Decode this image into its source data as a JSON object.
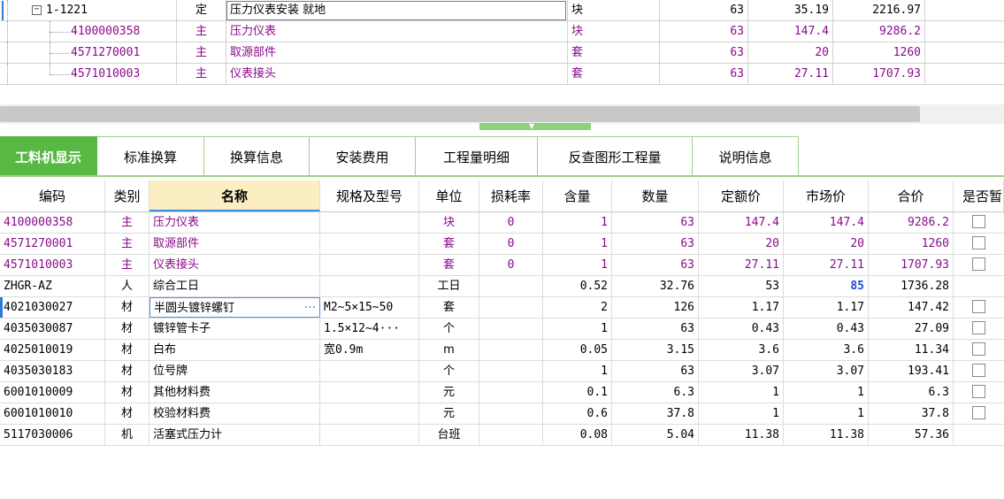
{
  "top_grid": {
    "rows": [
      {
        "code": "1-1221",
        "type": "定",
        "name": "压力仪表安装 就地",
        "unit": "块",
        "qty": "63",
        "price": "35.19",
        "total": "2216.97",
        "purple": false
      },
      {
        "code": "4100000358",
        "type": "主",
        "name": "压力仪表",
        "unit": "块",
        "qty": "63",
        "price": "147.4",
        "total": "9286.2",
        "purple": true
      },
      {
        "code": "4571270001",
        "type": "主",
        "name": "取源部件",
        "unit": "套",
        "qty": "63",
        "price": "20",
        "total": "1260",
        "purple": true
      },
      {
        "code": "4571010003",
        "type": "主",
        "name": "仪表接头",
        "unit": "套",
        "qty": "63",
        "price": "27.11",
        "total": "1707.93",
        "purple": true
      }
    ],
    "expander_symbol": "−"
  },
  "tabs": [
    {
      "label": "工料机显示",
      "active": true
    },
    {
      "label": "标准换算",
      "active": false
    },
    {
      "label": "换算信息",
      "active": false
    },
    {
      "label": "安装费用",
      "active": false
    },
    {
      "label": "工程量明细",
      "active": false
    },
    {
      "label": "反查图形工程量",
      "active": false
    },
    {
      "label": "说明信息",
      "active": false
    }
  ],
  "bottom_grid": {
    "headers": {
      "code": "编码",
      "type": "类别",
      "name": "名称",
      "spec": "规格及型号",
      "unit": "单位",
      "loss": "损耗率",
      "qty": "含量",
      "amount": "数量",
      "dprice": "定额价",
      "mprice": "市场价",
      "total": "合价",
      "temp": "是否暂"
    },
    "rows": [
      {
        "code": "4100000358",
        "type": "主",
        "name": "压力仪表",
        "spec": "",
        "unit": "块",
        "loss": "0",
        "qty": "1",
        "amount": "63",
        "dprice": "147.4",
        "mprice": "147.4",
        "total": "9286.2",
        "checkbox": true,
        "purple": true
      },
      {
        "code": "4571270001",
        "type": "主",
        "name": "取源部件",
        "spec": "",
        "unit": "套",
        "loss": "0",
        "qty": "1",
        "amount": "63",
        "dprice": "20",
        "mprice": "20",
        "total": "1260",
        "checkbox": true,
        "purple": true
      },
      {
        "code": "4571010003",
        "type": "主",
        "name": "仪表接头",
        "spec": "",
        "unit": "套",
        "loss": "0",
        "qty": "1",
        "amount": "63",
        "dprice": "27.11",
        "mprice": "27.11",
        "total": "1707.93",
        "checkbox": true,
        "purple": true
      },
      {
        "code": "ZHGR-AZ",
        "type": "人",
        "name": "综合工日",
        "spec": "",
        "unit": "工日",
        "loss": "",
        "qty": "0.52",
        "amount": "32.76",
        "dprice": "53",
        "mprice": "85",
        "total": "1736.28",
        "checkbox": false,
        "purple": false,
        "mprice_highlight": true
      },
      {
        "code": "4021030027",
        "type": "材",
        "name": "半圆头镀锌螺钉",
        "spec": "M2~5×15~50",
        "unit": "套",
        "loss": "",
        "qty": "2",
        "amount": "126",
        "dprice": "1.17",
        "mprice": "1.17",
        "total": "147.42",
        "checkbox": true,
        "purple": false,
        "editing": true
      },
      {
        "code": "4035030087",
        "type": "材",
        "name": "镀锌管卡子",
        "spec": "1.5×12~4···",
        "unit": "个",
        "loss": "",
        "qty": "1",
        "amount": "63",
        "dprice": "0.43",
        "mprice": "0.43",
        "total": "27.09",
        "checkbox": true,
        "purple": false
      },
      {
        "code": "4025010019",
        "type": "材",
        "name": "白布",
        "spec": "宽0.9m",
        "unit": "m",
        "loss": "",
        "qty": "0.05",
        "amount": "3.15",
        "dprice": "3.6",
        "mprice": "3.6",
        "total": "11.34",
        "checkbox": true,
        "purple": false
      },
      {
        "code": "4035030183",
        "type": "材",
        "name": "位号牌",
        "spec": "",
        "unit": "个",
        "loss": "",
        "qty": "1",
        "amount": "63",
        "dprice": "3.07",
        "mprice": "3.07",
        "total": "193.41",
        "checkbox": true,
        "purple": false
      },
      {
        "code": "6001010009",
        "type": "材",
        "name": "其他材料费",
        "spec": "",
        "unit": "元",
        "loss": "",
        "qty": "0.1",
        "amount": "6.3",
        "dprice": "1",
        "mprice": "1",
        "total": "6.3",
        "checkbox": true,
        "purple": false
      },
      {
        "code": "6001010010",
        "type": "材",
        "name": "校验材料费",
        "spec": "",
        "unit": "元",
        "loss": "",
        "qty": "0.6",
        "amount": "37.8",
        "dprice": "1",
        "mprice": "1",
        "total": "37.8",
        "checkbox": true,
        "purple": false
      },
      {
        "code": "5117030006",
        "type": "机",
        "name": "活塞式压力计",
        "spec": "",
        "unit": "台班",
        "loss": "",
        "qty": "0.08",
        "amount": "5.04",
        "dprice": "11.38",
        "mprice": "11.38",
        "total": "57.36",
        "checkbox": false,
        "purple": false
      }
    ],
    "ellipsis": "···"
  },
  "colors": {
    "accent_green": "#57b843",
    "purple_text": "#8b0a8b",
    "highlight_blue": "#1f4bd6",
    "header_highlight": "#fbeec2"
  }
}
